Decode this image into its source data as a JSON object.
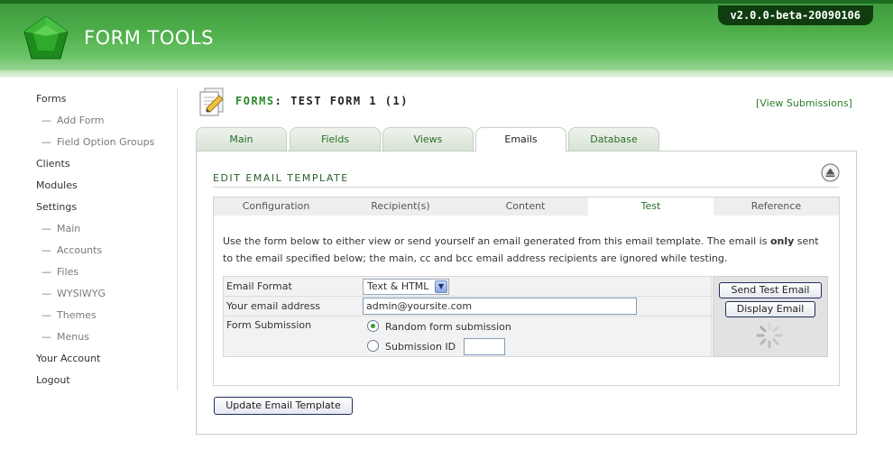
{
  "header": {
    "logo_text": "FORM TOOLS",
    "version": "v2.0.0-beta-20090106",
    "colors": {
      "brand_green": "#4fb04c",
      "version_bg": "#0f3d10"
    }
  },
  "sidebar": {
    "items": [
      {
        "label": "Forms",
        "sub": false
      },
      {
        "label": "Add Form",
        "sub": true
      },
      {
        "label": "Field Option Groups",
        "sub": true
      },
      {
        "label": "Clients",
        "sub": false
      },
      {
        "label": "Modules",
        "sub": false
      },
      {
        "label": "Settings",
        "sub": false
      },
      {
        "label": "Main",
        "sub": true
      },
      {
        "label": "Accounts",
        "sub": true
      },
      {
        "label": "Files",
        "sub": true
      },
      {
        "label": "WYSIWYG",
        "sub": true
      },
      {
        "label": "Themes",
        "sub": true
      },
      {
        "label": "Menus",
        "sub": true
      },
      {
        "label": "Your Account",
        "sub": false
      },
      {
        "label": "Logout",
        "sub": false
      }
    ],
    "sub_prefix": "—"
  },
  "page": {
    "title_prefix": "FORMS",
    "title_rest": ": TEST FORM 1 (1)",
    "view_submissions": "[View Submissions]"
  },
  "tabs": [
    {
      "label": "Main",
      "active": false
    },
    {
      "label": "Fields",
      "active": false
    },
    {
      "label": "Views",
      "active": false
    },
    {
      "label": "Emails",
      "active": true
    },
    {
      "label": "Database",
      "active": false
    }
  ],
  "section": {
    "title": "EDIT EMAIL TEMPLATE"
  },
  "inner_tabs": [
    {
      "label": "Configuration",
      "active": false
    },
    {
      "label": "Recipient(s)",
      "active": false
    },
    {
      "label": "Content",
      "active": false
    },
    {
      "label": "Test",
      "active": true
    },
    {
      "label": "Reference",
      "active": false
    }
  ],
  "description": {
    "part1": "Use the form below to either view or send yourself an email generated from this email template. The email is ",
    "bold": "only",
    "part2": " sent to the email specified below; the main, cc and bcc email address recipients are ignored while testing."
  },
  "form": {
    "email_format_label": "Email Format",
    "email_format_value": "Text & HTML",
    "email_address_label": "Your email address",
    "email_address_value": "admin@yoursite.com",
    "submission_label": "Form Submission",
    "radio_random": "Random form submission",
    "radio_random_checked": true,
    "radio_id": "Submission ID",
    "submission_id_value": ""
  },
  "actions": {
    "send_test_email": "Send Test Email",
    "display_email": "Display Email"
  },
  "footer": {
    "update_button": "Update Email Template"
  }
}
